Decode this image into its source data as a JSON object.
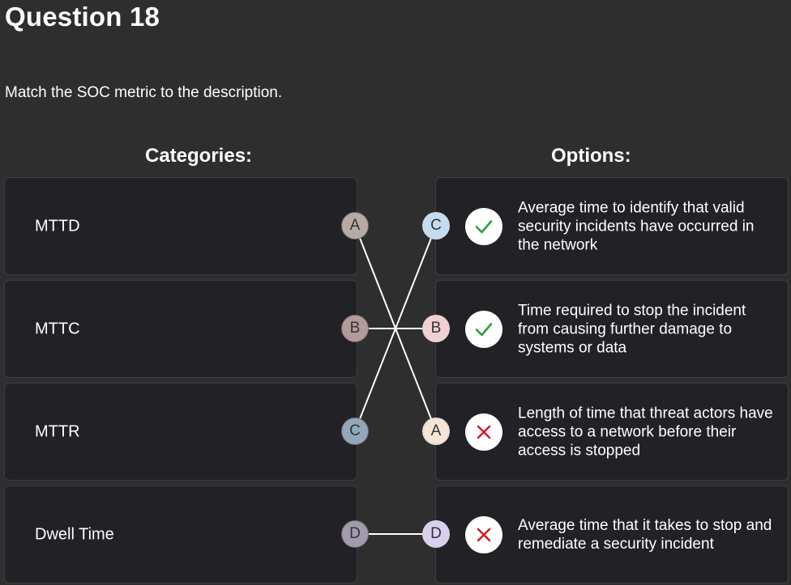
{
  "question_title": "Question 18",
  "prompt": "Match the SOC metric to the description.",
  "categories_header": "Categories:",
  "options_header": "Options:",
  "categories": [
    {
      "label": "MTTD",
      "letter": "A",
      "color": "#b7aaa5"
    },
    {
      "label": "MTTC",
      "letter": "B",
      "color": "#b59a9b"
    },
    {
      "label": "MTTR",
      "letter": "C",
      "color": "#93a7bb"
    },
    {
      "label": "Dwell Time",
      "letter": "D",
      "color": "#a29aae"
    }
  ],
  "options": [
    {
      "letter": "C",
      "color": "#c4dcf3",
      "status": "correct",
      "text": "Average time to identify that valid security incidents have occurred in the network"
    },
    {
      "letter": "B",
      "color": "#f4cfd0",
      "status": "correct",
      "text": "Time required to stop the incident from causing further damage to systems or data"
    },
    {
      "letter": "A",
      "color": "#f7e5d5",
      "status": "incorrect",
      "text": "Length of time that threat actors have access to a network before their access is stopped"
    },
    {
      "letter": "D",
      "color": "#d9cfee",
      "status": "incorrect",
      "text": "Average time that it takes to stop and remediate a security incident"
    }
  ],
  "colors": {
    "correct": "#2e9e3a",
    "incorrect": "#d21f2a",
    "background": "#2e2e2e",
    "card": "#212126"
  }
}
